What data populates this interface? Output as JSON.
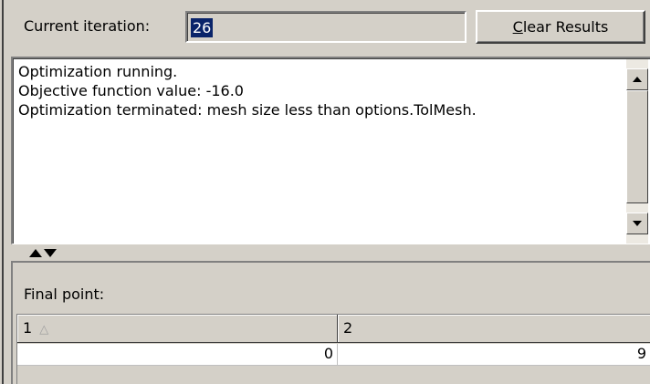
{
  "iteration": {
    "label": "Current iteration:",
    "value": "26"
  },
  "clear_button": {
    "mnemonic": "C",
    "rest": "lear Results"
  },
  "output": {
    "lines": [
      "Optimization running.",
      "Objective function value: -16.0",
      "Optimization terminated: mesh size less than options.TolMesh."
    ]
  },
  "final_point": {
    "title": "Final point:",
    "columns": [
      "1",
      "2"
    ],
    "sort_icon": "sort-ascending-icon",
    "values": [
      "0",
      "9"
    ]
  },
  "colors": {
    "window_bg": "#d4d0c8",
    "selection": "#0a246a"
  }
}
